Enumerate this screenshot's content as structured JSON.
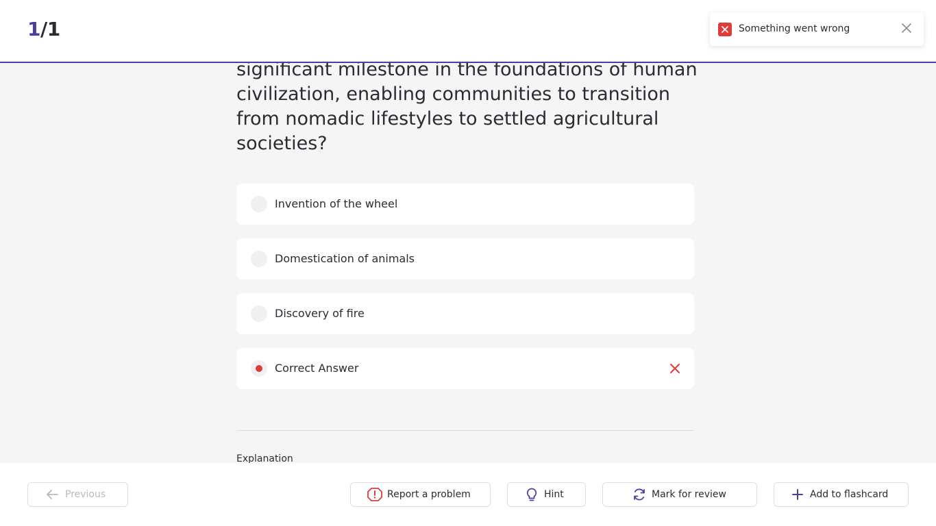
{
  "header": {
    "current": "1",
    "total": "/1"
  },
  "toast": {
    "message": "Something went wrong",
    "icon": "error-x-icon",
    "color": "#e03b3b"
  },
  "question": {
    "text": "significant milestone in the foundations of human civilization, enabling communities to transition from nomadic lifestyles to settled agricultural societies?"
  },
  "options": [
    {
      "label": "Invention of the wheel",
      "selected": false
    },
    {
      "label": "Domestication of animals",
      "selected": false
    },
    {
      "label": "Discovery of fire",
      "selected": false
    },
    {
      "label": "Correct Answer",
      "selected": true,
      "status": "incorrect"
    }
  ],
  "explanation": {
    "heading": "Explanation"
  },
  "footer": {
    "previous_label": "Previous",
    "report_label": "Report a problem",
    "hint_label": "Hint",
    "review_label": "Mark for review",
    "flashcard_label": "Add to flashcard"
  },
  "colors": {
    "accent": "#4a3f9b",
    "error": "#e03b3b",
    "background": "#f5f5f5"
  }
}
